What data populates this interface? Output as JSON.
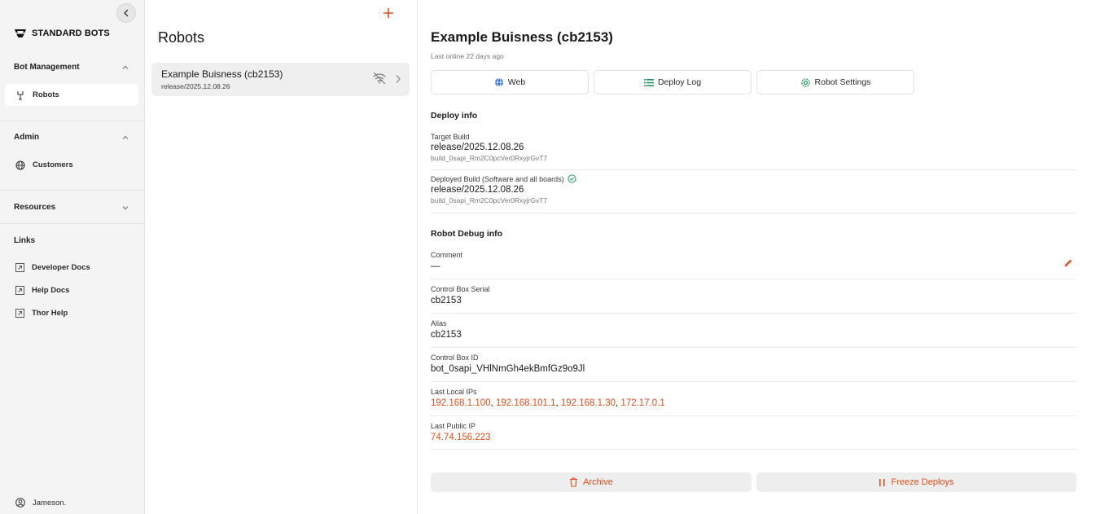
{
  "brand": {
    "name": "STANDARD BOTS",
    "accent": "#e04e1b"
  },
  "sidebar": {
    "sections": [
      {
        "label": "Bot Management",
        "expanded": true,
        "items": [
          {
            "label": "Robots",
            "icon": "robot-arm-icon",
            "active": true
          }
        ]
      },
      {
        "label": "Admin",
        "expanded": true,
        "items": [
          {
            "label": "Customers",
            "icon": "globe-icon"
          }
        ]
      },
      {
        "label": "Resources",
        "expanded": false
      }
    ],
    "links_header": "Links",
    "links": [
      "Developer Docs",
      "Help Docs",
      "Thor Help"
    ],
    "user": "Jameson."
  },
  "list": {
    "title": "Robots",
    "robots": [
      {
        "name": "Example Buisness (cb2153)",
        "release": "release/2025.12.08.26",
        "status_icon": "wifi-off-icon"
      }
    ]
  },
  "details": {
    "title": "Example Buisness (cb2153)",
    "last_online": "Last online 22 days ago",
    "tabs": [
      "Web",
      "Deploy Log",
      "Robot Settings"
    ],
    "deploy_info": {
      "title": "Deploy info",
      "target_build_label": "Target Build",
      "target_build": "release/2025.12.08.26",
      "target_build_id": "build_0sapi_Rm2C0pcVer0RxyjrGvT7",
      "deployed_build_label": "Deployed Build (Software and all boards)",
      "deployed_build": "release/2025.12.08.26",
      "deployed_build_id": "build_0sapi_Rm2C0pcVer0RxyjrGvT7"
    },
    "debug_info": {
      "title": "Robot Debug info",
      "comment_label": "Comment",
      "comment": "—",
      "serial_label": "Control Box Serial",
      "serial": "cb2153",
      "alias_label": "Alias",
      "alias": "cb2153",
      "box_id_label": "Control Box ID",
      "box_id": "bot_0sapi_VHlNmGh4ekBmfGz9o9Jl",
      "local_ips_label": "Last Local IPs",
      "local_ips": [
        "192.168.1.100",
        "192.168.101.1",
        "192.168.1.30",
        "172.17.0.1"
      ],
      "public_ip_label": "Last Public IP",
      "public_ip": "74.74.156.223"
    },
    "actions": {
      "archive": "Archive",
      "freeze": "Freeze Deploys"
    }
  }
}
